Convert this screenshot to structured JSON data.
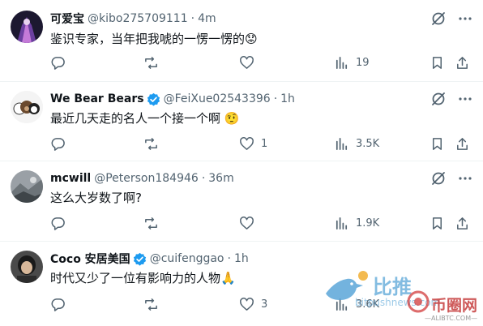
{
  "tweets": [
    {
      "name": "可爱宝",
      "handle": "@kibo275709111",
      "sep": "·",
      "time": "4m",
      "verified": false,
      "text": "鉴识专家，当年把我唬的一愣一愣的😟",
      "replies": "",
      "retweets": "",
      "likes": "",
      "views": "19"
    },
    {
      "name": "We Bear Bears",
      "handle": "@FeiXue02543396",
      "sep": "·",
      "time": "1h",
      "verified": true,
      "text": "最近几天走的名人一个接一个啊 🤨",
      "replies": "",
      "retweets": "",
      "likes": "1",
      "views": "3.5K"
    },
    {
      "name": "mcwill",
      "handle": "@Peterson184946",
      "sep": "·",
      "time": "36m",
      "verified": false,
      "text": "这么大岁数了啊?",
      "replies": "",
      "retweets": "",
      "likes": "",
      "views": "1.9K"
    },
    {
      "name": "Coco 安居美国",
      "handle": "@cuifenggao",
      "sep": "·",
      "time": "1h",
      "verified": true,
      "text": "时代又少了一位有影响力的人物🙏",
      "replies": "",
      "retweets": "",
      "likes": "3",
      "views": "3.6K"
    }
  ],
  "watermark": {
    "brand_cn": "比推",
    "brand_url": "bitpushnews.com",
    "site_cn": "币圈网",
    "site_url": "—ALIBTC.COM—"
  },
  "colors": {
    "text": "#0f1419",
    "secondary": "#536471",
    "verified": "#1d9bf0",
    "divider": "#eff3f4"
  }
}
